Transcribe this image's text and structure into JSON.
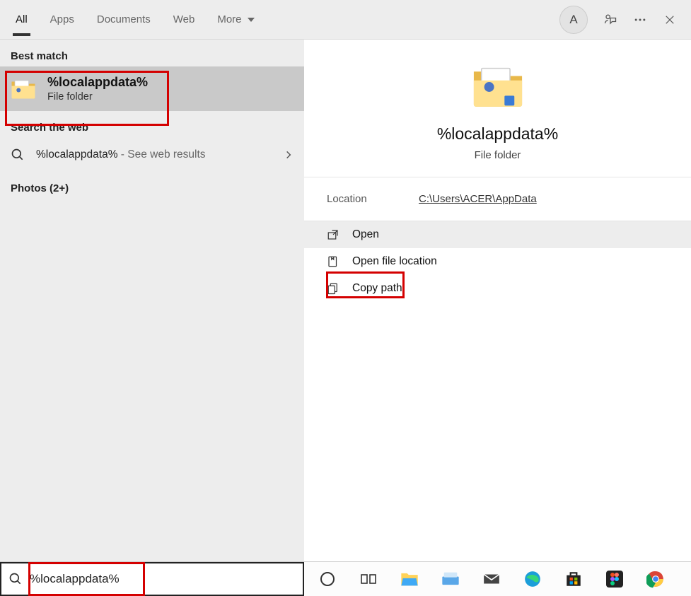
{
  "tabs": {
    "all": "All",
    "apps": "Apps",
    "documents": "Documents",
    "web": "Web",
    "more": "More"
  },
  "avatar_letter": "A",
  "sections": {
    "best_match": "Best match",
    "search_web": "Search the web",
    "photos": "Photos (2+)"
  },
  "best_match": {
    "title": "%localappdata%",
    "subtitle": "File folder"
  },
  "web_result": {
    "query": "%localappdata%",
    "suffix": " - See web results"
  },
  "detail": {
    "title": "%localappdata%",
    "subtitle": "File folder",
    "location_label": "Location",
    "location_value": "C:\\Users\\ACER\\AppData"
  },
  "actions": {
    "open": "Open",
    "open_location": "Open file location",
    "copy_path": "Copy path"
  },
  "search_input": "%localappdata%"
}
